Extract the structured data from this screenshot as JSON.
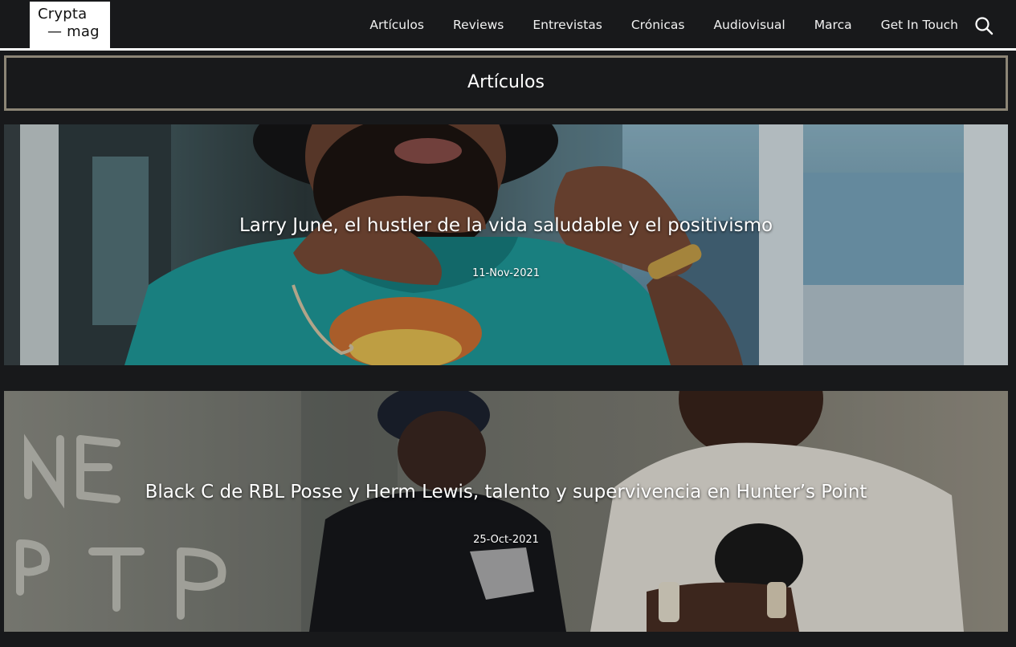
{
  "site": {
    "logo_line1": "Crypta",
    "logo_line2": "— mag"
  },
  "nav": {
    "items": [
      "Artículos",
      "Reviews",
      "Entrevistas",
      "Crónicas",
      "Audiovisual",
      "Marca",
      "Get In Touch"
    ],
    "search_icon": "search-icon"
  },
  "section": {
    "title": "Artículos"
  },
  "articles": [
    {
      "title": "Larry June, el hustler de la vida saludable y el positivismo",
      "date": "11-Nov-2021"
    },
    {
      "title": "Black C de RBL Posse y Herm Lewis, talento y supervivencia en Hunter’s Point",
      "date": "25-Oct-2021"
    }
  ],
  "colors": {
    "background": "#18191b",
    "section_border": "#8c8576",
    "logo_bg": "#ffffff"
  }
}
